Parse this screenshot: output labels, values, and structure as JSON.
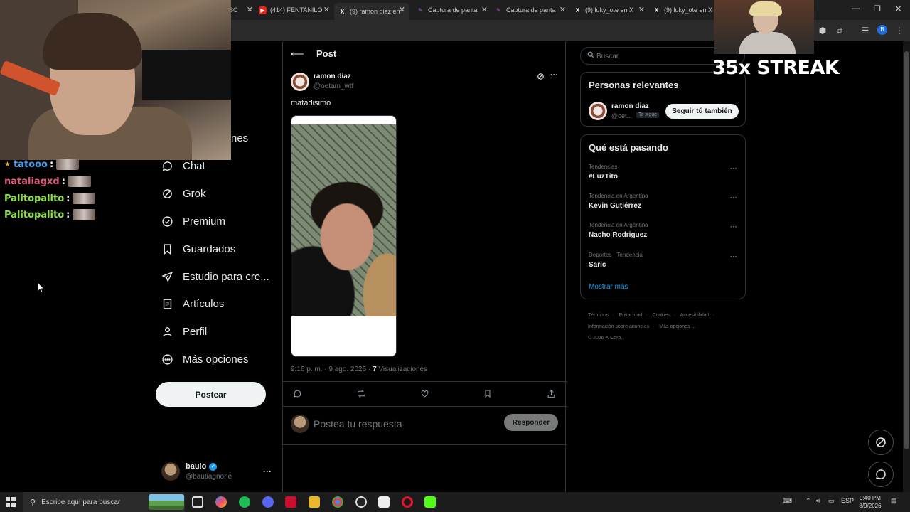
{
  "browser": {
    "tabs": [
      {
        "title": "(414) FENTANILO",
        "icon": "youtube-icon",
        "active": false
      },
      {
        "title": "(9) ramon diaz en",
        "icon": "x-logo-icon",
        "active": true
      },
      {
        "title": "Captura de panta",
        "icon": "pen-icon",
        "active": false
      },
      {
        "title": "Captura de panta",
        "icon": "pen-icon",
        "active": false
      },
      {
        "title": "(9) luky_ote en X",
        "icon": "x-logo-icon",
        "active": false
      },
      {
        "title": "(9) luky_ote en X",
        "icon": "x-logo-icon",
        "active": false
      }
    ],
    "profile_initial": "B"
  },
  "stream_overlay": {
    "streak_text": "35x STREAK",
    "chat": [
      {
        "user": "tatooo",
        "color": "#4a9be8",
        "badge": true
      },
      {
        "user": "nataliagxd",
        "color": "#e05a7a",
        "badge": false
      },
      {
        "user": "Palitopalito",
        "color": "#8be04a",
        "badge": false
      },
      {
        "user": "Palitopalito",
        "color": "#8be04a",
        "badge": false
      }
    ],
    "chat_separator": ":"
  },
  "nav": {
    "partial_item": "nes",
    "items": [
      {
        "label": "Chat",
        "icon": "chat-bubble-icon"
      },
      {
        "label": "Grok",
        "icon": "grok-icon"
      },
      {
        "label": "Premium",
        "icon": "verified-badge-icon"
      },
      {
        "label": "Guardados",
        "icon": "bookmark-icon"
      },
      {
        "label": "Estudio para cre...",
        "icon": "rocket-icon"
      },
      {
        "label": "Artículos",
        "icon": "article-icon"
      },
      {
        "label": "Perfil",
        "icon": "person-icon"
      },
      {
        "label": "Más opciones",
        "icon": "more-circle-icon"
      }
    ],
    "post_button": "Postear",
    "account": {
      "name": "baulo",
      "handle": "@bautiagnone"
    }
  },
  "post": {
    "header_title": "Post",
    "author_name": "ramon diaz",
    "author_handle": "@oetam_wtf",
    "text": "matadisimo",
    "timestamp": "9:16 p. m. · 9 ago. 2026 · ",
    "views_count": "7",
    "views_label": " Visualizaciones",
    "reply_placeholder": "Postea tu respuesta",
    "reply_button": "Responder"
  },
  "sidebar": {
    "search_placeholder": "Buscar",
    "relevant_title": "Personas relevantes",
    "relevant_person": {
      "name": "ramon diaz",
      "handle": "@oet...",
      "badge": "Te sigue",
      "follow_button": "Seguir tú también"
    },
    "trending_title": "Qué está pasando",
    "trends": [
      {
        "context": "Tendencias",
        "name": "#LuzTito"
      },
      {
        "context": "Tendencia en Argentina",
        "name": "Kevin Gutiérrez"
      },
      {
        "context": "Tendencia en Argentina",
        "name": "Nacho Rodriguez"
      },
      {
        "context": "Deportes · Tendencia",
        "name": "Saric"
      }
    ],
    "show_more": "Mostrar más",
    "footer": [
      "Términos",
      "·",
      "Privacidad",
      "·",
      "Cookies",
      "·",
      "Accesibilidad",
      "·",
      "Información sobre anuncios",
      "·",
      "Más opciones ...",
      "© 2026 X Corp."
    ]
  },
  "taskbar": {
    "search_placeholder": "Escribe aquí para buscar",
    "language": "ESP",
    "time": "9:40 PM",
    "date": "8/9/2026"
  },
  "colors": {
    "accent": "#1d9bf0",
    "background": "#000000",
    "border": "#2f3336",
    "muted_text": "#71767b"
  }
}
